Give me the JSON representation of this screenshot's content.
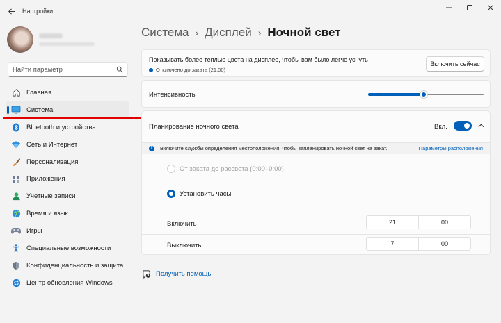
{
  "app": {
    "title": "Настройки"
  },
  "search": {
    "placeholder": "Найти параметр"
  },
  "sidebar": {
    "items": [
      {
        "label": "Главная",
        "icon": "home-icon",
        "active": false
      },
      {
        "label": "Система",
        "icon": "system-icon",
        "active": true
      },
      {
        "label": "Bluetooth и устройства",
        "icon": "bluetooth-icon",
        "active": false
      },
      {
        "label": "Сеть и Интернет",
        "icon": "network-icon",
        "active": false
      },
      {
        "label": "Персонализация",
        "icon": "brush-icon",
        "active": false
      },
      {
        "label": "Приложения",
        "icon": "apps-icon",
        "active": false
      },
      {
        "label": "Учетные записи",
        "icon": "accounts-icon",
        "active": false
      },
      {
        "label": "Время и язык",
        "icon": "globe-icon",
        "active": false
      },
      {
        "label": "Игры",
        "icon": "gamepad-icon",
        "active": false
      },
      {
        "label": "Специальные возможности",
        "icon": "accessibility-icon",
        "active": false
      },
      {
        "label": "Конфиденциальность и защита",
        "icon": "shield-icon",
        "active": false
      },
      {
        "label": "Центр обновления Windows",
        "icon": "update-icon",
        "active": false
      }
    ]
  },
  "breadcrumb": {
    "level1": "Система",
    "level2": "Дисплей",
    "current": "Ночной свет",
    "separator": "›"
  },
  "night_light": {
    "description": "Показывать более теплые цвета на дисплее, чтобы вам было легче уснуть",
    "status": "Отключено до заката (21:00)",
    "turn_on_button": "Включить сейчас"
  },
  "intensity": {
    "label": "Интенсивность",
    "value_fraction": 0.48
  },
  "schedule": {
    "label": "Планирование ночного света",
    "toggle_text": "Вкл.",
    "toggle_on": true,
    "info_text": "Включите службы определения местоположения, чтобы запланировать ночной свет на закат.",
    "info_link": "Параметры расположения",
    "option_sunset": "От заката до рассвета (0:00–0:00)",
    "option_set_hours": "Установить часы",
    "selected_option": "set_hours",
    "turn_on": {
      "label": "Включить",
      "hour": "21",
      "minute": "00"
    },
    "turn_off": {
      "label": "Выключить",
      "hour": "7",
      "minute": "00"
    }
  },
  "help": {
    "label": "Получить помощь"
  },
  "colors": {
    "accent": "#005fb8",
    "annotation_red": "#e00000"
  }
}
